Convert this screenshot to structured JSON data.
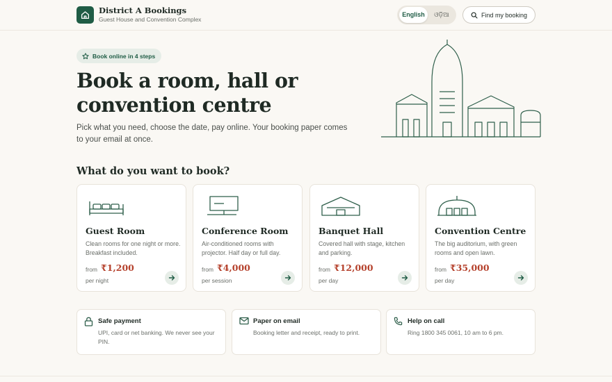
{
  "header": {
    "brand_title": "District A Bookings",
    "brand_subtitle": "Guest House and Convention Complex",
    "logo_icon": "house-icon",
    "languages": [
      "English",
      "ଓଡ଼ିଆ"
    ],
    "active_language": "English",
    "find_booking_label": "Find my booking",
    "find_booking_icon": "search-icon"
  },
  "hero": {
    "pill_label": "Book online in 4 steps",
    "pill_icon": "star-icon",
    "title": "Book a room, hall or convention centre",
    "subtitle": "Pick what you need, choose the date, pay online. Your booking paper comes to your email at once.",
    "illustration_icon": "city-skyline-illustration"
  },
  "section_title": "What do you want to book?",
  "cards": [
    {
      "icon": "bed-icon",
      "name": "Guest Room",
      "desc": "Clean rooms for one night or more. Breakfast included.",
      "from_label": "from",
      "price": "₹1,200",
      "unit": "per night"
    },
    {
      "icon": "projector-screen-icon",
      "name": "Conference Room",
      "desc": "Air-conditioned rooms with projector. Half day or full day.",
      "from_label": "from",
      "price": "₹4,000",
      "unit": "per session"
    },
    {
      "icon": "hall-building-icon",
      "name": "Banquet Hall",
      "desc": "Covered hall with stage, kitchen and parking.",
      "from_label": "from",
      "price": "₹12,000",
      "unit": "per day"
    },
    {
      "icon": "dome-auditorium-icon",
      "name": "Convention Centre",
      "desc": "The big auditorium, with green rooms and open lawn.",
      "from_label": "from",
      "price": "₹35,000",
      "unit": "per day"
    }
  ],
  "features": [
    {
      "icon": "lock-icon",
      "title": "Safe payment",
      "desc": "UPI, card or net banking. We never see your PIN."
    },
    {
      "icon": "mail-icon",
      "title": "Paper on email",
      "desc": "Booking letter and receipt, ready to print."
    },
    {
      "icon": "phone-icon",
      "title": "Help on call",
      "desc": "Ring 1800 345 0061, 10 am to 6 pm."
    }
  ],
  "colors": {
    "brand": "#1f5c45",
    "accent_price": "#b5412c",
    "background": "#faf8f4",
    "pill_bg": "#e6ede7"
  }
}
